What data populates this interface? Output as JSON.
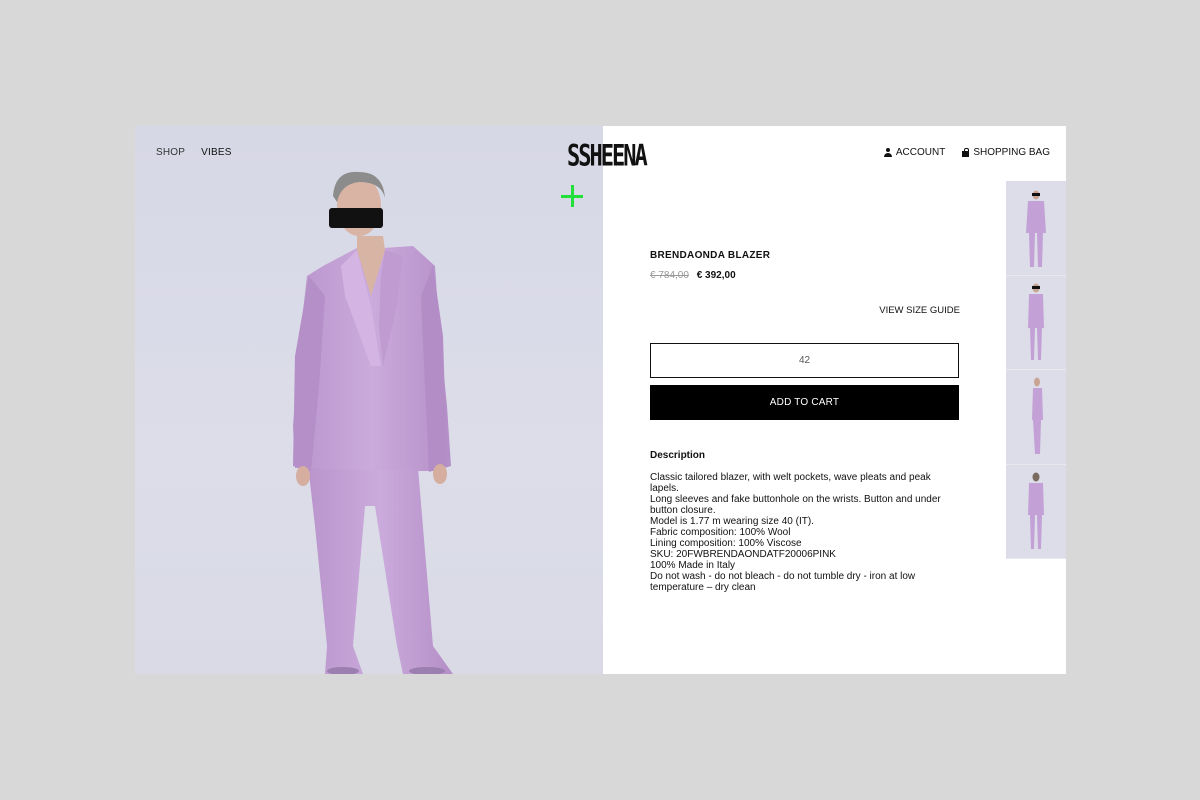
{
  "nav": {
    "shop": "SHOP",
    "vibes": "VIBES"
  },
  "brand": {
    "logo": "SSHEENA"
  },
  "account": {
    "account_label": "ACCOUNT",
    "bag_label": "SHOPPING BAG"
  },
  "product": {
    "title": "BRENDAONDA BLAZER",
    "price_old": "€ 784,00",
    "price_new": "€ 392,00",
    "size_guide": "VIEW SIZE GUIDE",
    "selected_size": "42",
    "add_to_cart": "ADD TO CART"
  },
  "description": {
    "title": "Description",
    "line1": "Classic tailored blazer, with welt pockets, wave pleats and peak lapels.",
    "line2": "Long sleeves and fake buttonhole on the wrists. Button and under button closure.",
    "line3": "Model is 1.77 m wearing size 40 (IT).",
    "line4": "Fabric composition: 100% Wool",
    "line5": "Lining composition: 100% Viscose",
    "sku": "SKU: 20FWBRENDAONDATF20006PINK",
    "made": "100% Made in Italy",
    "care": "Do not wash - do not bleach - do not tumble dry - iron at low temperature – dry clean"
  },
  "colors": {
    "accent_plus": "#22e03a",
    "suit": "#c7a6d8",
    "background": "#d8d8d8"
  },
  "icons": [
    "user-icon",
    "bag-icon",
    "plus-icon"
  ]
}
